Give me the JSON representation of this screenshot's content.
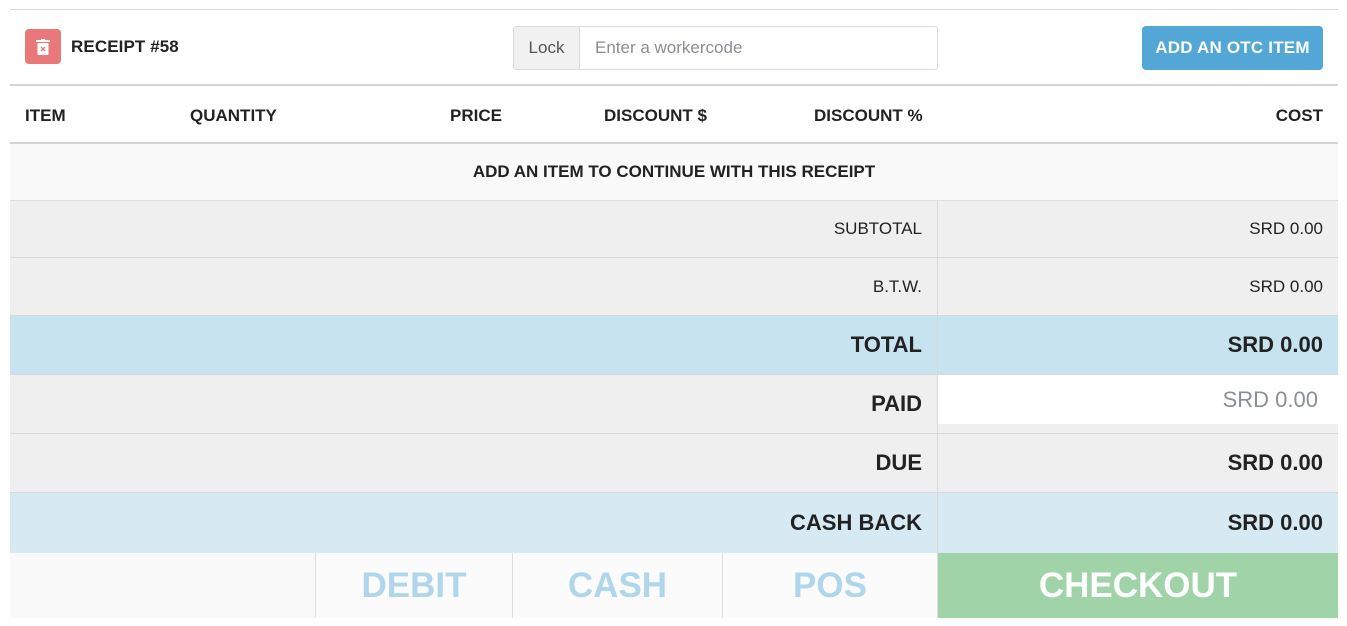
{
  "header": {
    "receipt_title": "RECEIPT #58",
    "lock_label": "Lock",
    "workercode_placeholder": "Enter a workercode",
    "add_otc_label": "ADD AN OTC ITEM",
    "icon_delete": "trash-icon"
  },
  "columns": {
    "item": "ITEM",
    "quantity": "QUANTITY",
    "price": "PRICE",
    "discount_amount": "DISCOUNT $",
    "discount_percent": "DISCOUNT %",
    "cost": "COST"
  },
  "empty_message": "ADD AN ITEM TO CONTINUE WITH THIS RECEIPT",
  "summary": {
    "subtotal_label": "SUBTOTAL",
    "subtotal_value": "SRD 0.00",
    "btw_label": "B.T.W.",
    "btw_value": "SRD 0.00",
    "total_label": "TOTAL",
    "total_value": "SRD 0.00",
    "paid_label": "PAID",
    "paid_placeholder": "SRD 0.00",
    "due_label": "DUE",
    "due_value": "SRD 0.00",
    "cashback_label": "CASH BACK",
    "cashback_value": "SRD 0.00"
  },
  "payment": {
    "debit_label": "DEBIT",
    "cash_label": "CASH",
    "pos_label": "POS",
    "checkout_label": "CHECKOUT"
  },
  "colors": {
    "delete_button": "#e8787a",
    "primary_button": "#52a7d6",
    "total_row": "#c7e3f0",
    "cashback_row": "#d7eaf4",
    "payment_text": "#b0d6eb",
    "checkout": "#a0d3a7"
  }
}
